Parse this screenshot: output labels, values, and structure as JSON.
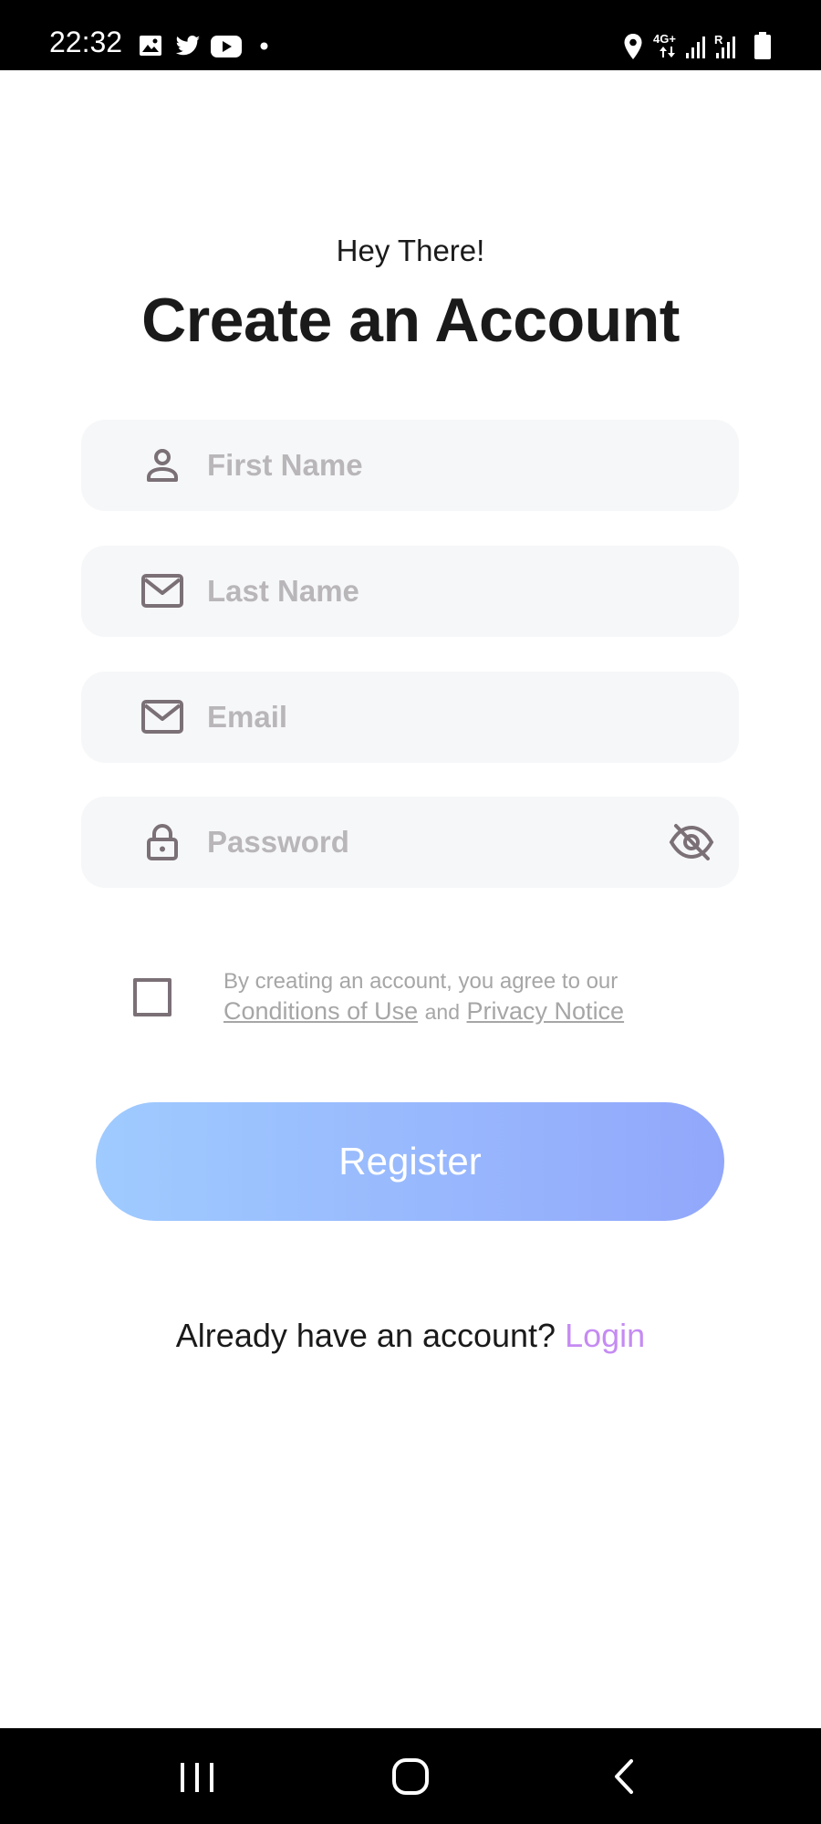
{
  "status_bar": {
    "time": "22:32",
    "network": "4G+",
    "icons": [
      "gallery-icon",
      "twitter-icon",
      "youtube-icon",
      "notification-dot-icon",
      "location-icon",
      "signal-icon",
      "roaming-signal-icon",
      "battery-icon"
    ]
  },
  "header": {
    "greeting": "Hey There!",
    "title": "Create an Account"
  },
  "form": {
    "first_name": {
      "placeholder": "First Name",
      "value": "",
      "icon": "person-icon"
    },
    "last_name": {
      "placeholder": "Last Name",
      "value": "",
      "icon": "mail-icon"
    },
    "email": {
      "placeholder": "Email",
      "value": "",
      "icon": "mail-icon"
    },
    "password": {
      "placeholder": "Password",
      "value": "",
      "icon": "lock-icon",
      "toggle_icon": "eye-off-icon"
    }
  },
  "terms": {
    "checked": false,
    "text": "By creating an account, you agree to our",
    "conditions_link": "Conditions of Use",
    "and": "and",
    "privacy_link": "Privacy Notice"
  },
  "register_label": "Register",
  "login_prompt": {
    "text": "Already have an account?",
    "link": "Login"
  },
  "nav_bar": {
    "buttons": [
      "recents-icon",
      "home-icon",
      "back-icon"
    ]
  },
  "colors": {
    "field_bg": "#f6f7f8",
    "placeholder": "#b9b6ba",
    "gradient_start": "#9fcbff",
    "gradient_end": "#92a7fb",
    "login_link": "#c58bf2",
    "title_text": "#1a1a1a"
  }
}
